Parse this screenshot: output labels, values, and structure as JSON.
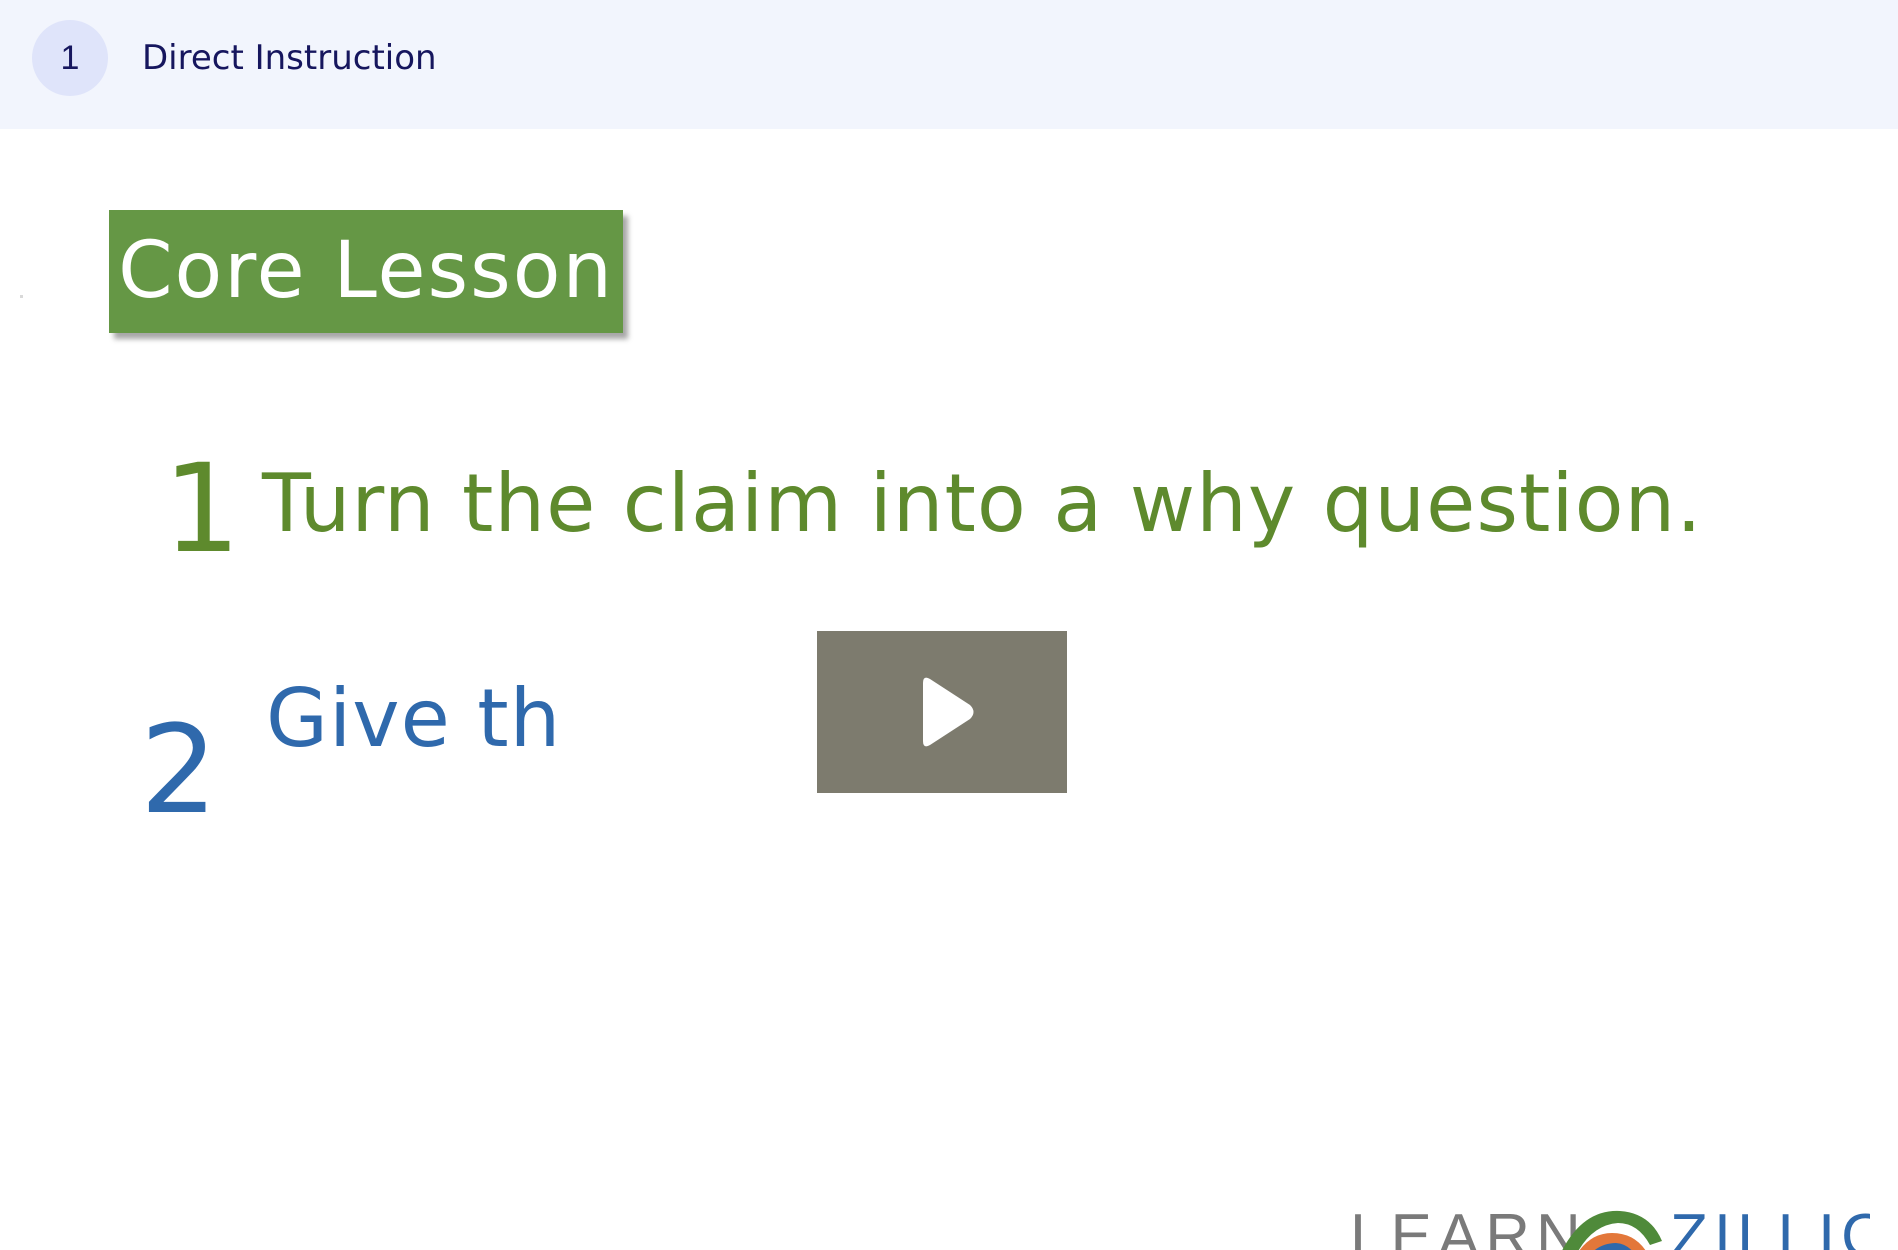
{
  "header": {
    "step_number": "1",
    "title": "Direct Instruction"
  },
  "video": {
    "badge_label": "Core Lesson",
    "steps": [
      {
        "number": "1",
        "text": "Turn the claim into a why question."
      },
      {
        "number": "2",
        "text": "Give th"
      }
    ],
    "play_icon": "play-icon",
    "logo_text": "LEARNZILLION",
    "colors": {
      "badge": "#659745",
      "step1": "#5e8a2d",
      "step2": "#2f69ac",
      "play_bg": "#7d7b6e",
      "header_bg": "#f2f5fd",
      "header_text": "#16165e"
    }
  }
}
